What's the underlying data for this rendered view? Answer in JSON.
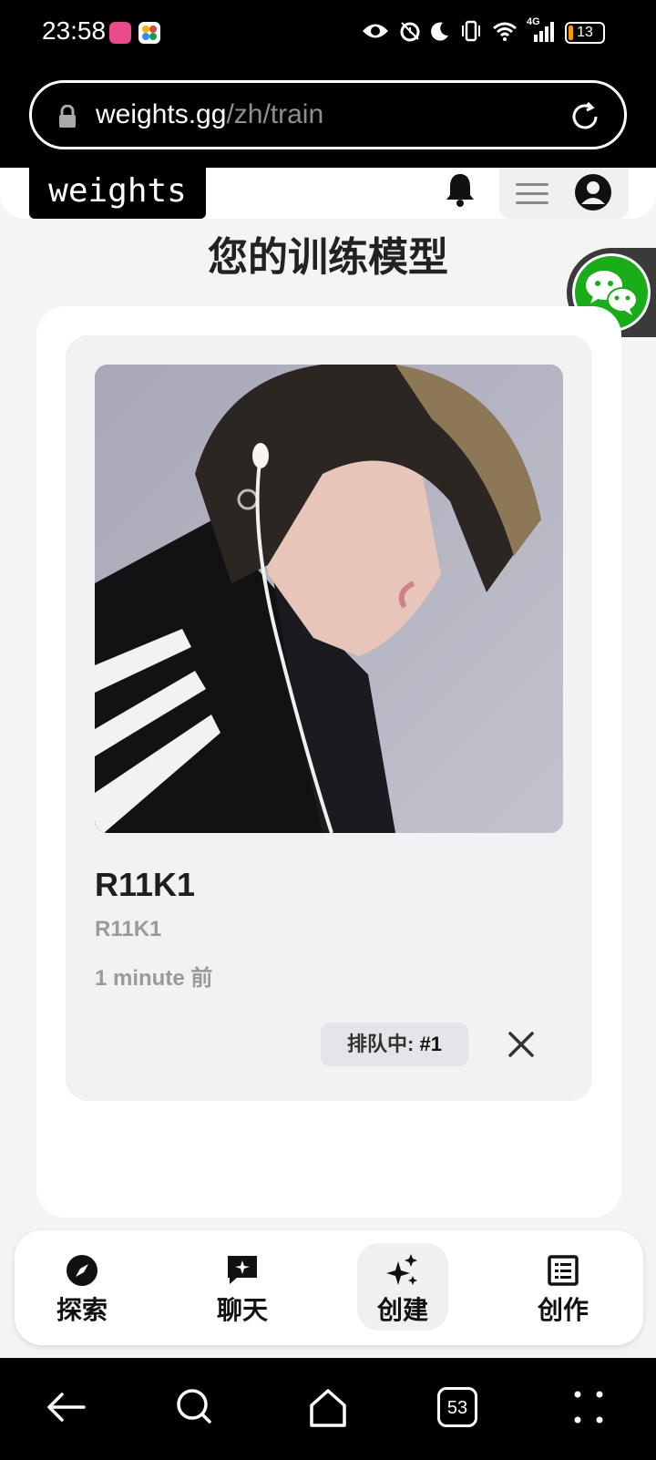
{
  "status_bar": {
    "time": "23:58",
    "battery": "13",
    "battery_level": 0.13,
    "network": "4G",
    "icons": [
      "eye-icon",
      "alarm-icon",
      "moon-icon",
      "vibrate-icon",
      "wifi-icon",
      "signal-icon",
      "battery-icon"
    ]
  },
  "browser": {
    "url_domain": "weights.gg",
    "url_path": "/zh/train"
  },
  "header": {
    "logo": "weights",
    "icons": [
      "bell-icon",
      "menu-icon",
      "account-icon"
    ]
  },
  "page": {
    "title": "您的训练模型"
  },
  "model": {
    "name": "R11K1",
    "subtitle": "R11K1",
    "time": "1 minute 前",
    "queue_label": "排队中: ",
    "queue_position": "#1"
  },
  "bottom_nav": {
    "items": [
      {
        "label": "探索",
        "icon": "compass-icon"
      },
      {
        "label": "聊天",
        "icon": "chat-icon"
      },
      {
        "label": "创建",
        "icon": "sparkles-icon"
      },
      {
        "label": "创作",
        "icon": "list-icon"
      }
    ]
  },
  "system_nav": {
    "tab_count": "53"
  },
  "colors": {
    "accent_wechat": "#1aad19",
    "background": "#f4f4f4",
    "card": "#f1f2f4"
  }
}
